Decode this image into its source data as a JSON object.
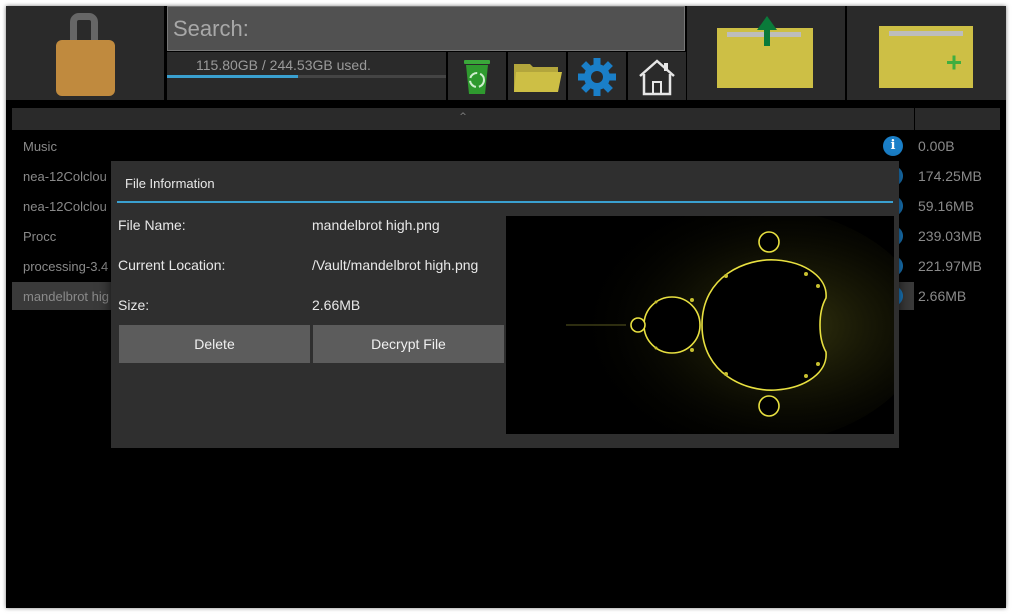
{
  "toolbar": {
    "search_placeholder": "Search:",
    "storage_text": "115.80GB / 244.53GB used.",
    "storage_fraction": 0.47
  },
  "list": {
    "header_arrow": "^",
    "rows": [
      {
        "name": "Music",
        "size": "0.00B"
      },
      {
        "name": "nea-12Colclou",
        "size": "174.25MB"
      },
      {
        "name": "nea-12Colclou",
        "size": "59.16MB"
      },
      {
        "name": "Procc",
        "size": "239.03MB"
      },
      {
        "name": "processing-3.4",
        "size": "221.97MB"
      },
      {
        "name": "mandelbrot hig",
        "size": "2.66MB"
      }
    ]
  },
  "dialog": {
    "title": "File Information",
    "name_label": "File Name:",
    "name_value": "mandelbrot high.png",
    "location_label": "Current Location:",
    "location_value": "/Vault/mandelbrot high.png",
    "size_label": "Size:",
    "size_value": "2.66MB",
    "delete_label": "Delete",
    "decrypt_label": "Decrypt File"
  },
  "colors": {
    "accent": "#3aa0d0",
    "lock": "#c08a3e",
    "folder": "#cdbf45",
    "info": "#1a7fc8"
  },
  "icons": [
    "lock-icon",
    "recycle-bin-icon",
    "folder-icon",
    "gear-icon",
    "home-icon",
    "upload-folder-icon",
    "new-folder-icon",
    "info-icon"
  ]
}
